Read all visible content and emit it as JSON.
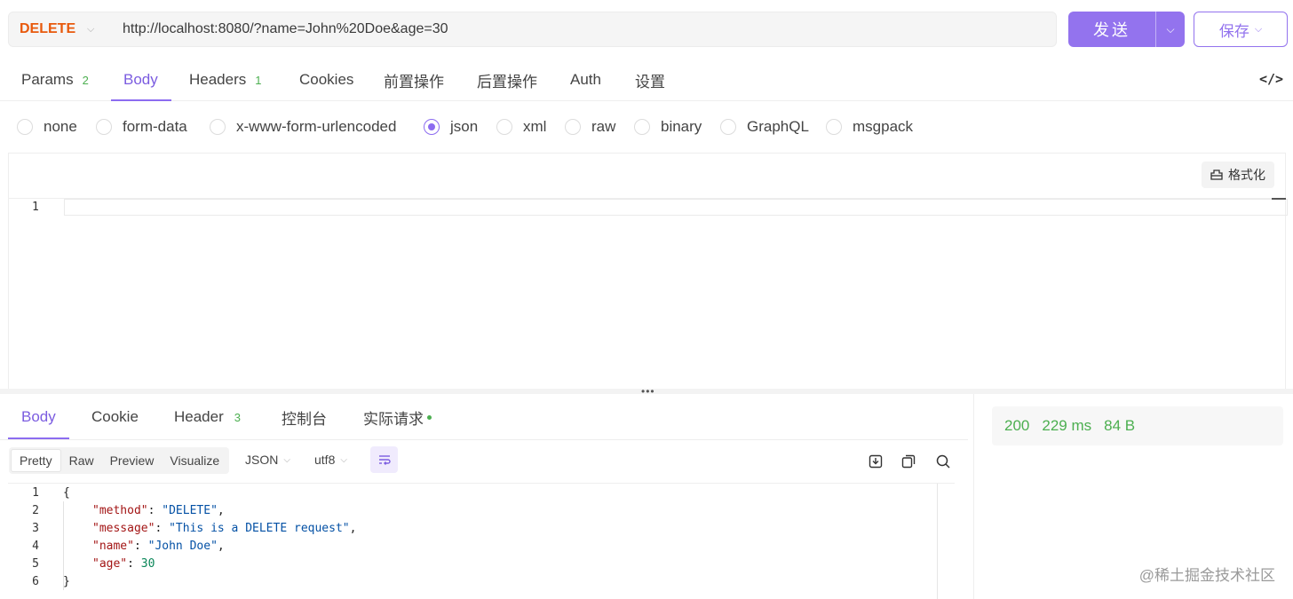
{
  "request": {
    "method": "DELETE",
    "url": "http://localhost:8080/?name=John%20Doe&age=30",
    "send_label": "发送",
    "save_label": "保存"
  },
  "request_tabs": [
    {
      "label": "Params",
      "count": "2"
    },
    {
      "label": "Body",
      "count": ""
    },
    {
      "label": "Headers",
      "count": "1"
    },
    {
      "label": "Cookies",
      "count": ""
    },
    {
      "label": "前置操作",
      "count": ""
    },
    {
      "label": "后置操作",
      "count": ""
    },
    {
      "label": "Auth",
      "count": ""
    },
    {
      "label": "设置",
      "count": ""
    }
  ],
  "code_toggle": "</>",
  "body_types": [
    "none",
    "form-data",
    "x-www-form-urlencoded",
    "json",
    "xml",
    "raw",
    "binary",
    "GraphQL",
    "msgpack"
  ],
  "selected_body_type": "json",
  "request_editor": {
    "format_label": "格式化",
    "line_number": "1"
  },
  "response_tabs": [
    {
      "label": "Body",
      "count": ""
    },
    {
      "label": "Cookie",
      "count": ""
    },
    {
      "label": "Header",
      "count": "3"
    },
    {
      "label": "控制台",
      "count": ""
    },
    {
      "label": "实际请求",
      "count": ""
    }
  ],
  "response_views": [
    "Pretty",
    "Raw",
    "Preview",
    "Visualize"
  ],
  "response_format": "JSON",
  "response_encoding": "utf8",
  "response_lines": [
    {
      "n": "1",
      "text": "{"
    },
    {
      "n": "2",
      "key": "\"method\"",
      "value": "\"DELETE\"",
      "type": "s",
      "comma": ","
    },
    {
      "n": "3",
      "key": "\"message\"",
      "value": "\"This is a DELETE request\"",
      "type": "s",
      "comma": ","
    },
    {
      "n": "4",
      "key": "\"name\"",
      "value": "\"John Doe\"",
      "type": "s",
      "comma": ","
    },
    {
      "n": "5",
      "key": "\"age\"",
      "value": "30",
      "type": "n",
      "comma": ""
    },
    {
      "n": "6",
      "text": "}"
    }
  ],
  "status": {
    "code": "200",
    "time": "229 ms",
    "size": "84 B"
  },
  "watermark": "@稀土掘金技术社区",
  "colors": {
    "accent": "#9373ee",
    "method": "#e8590c",
    "success": "#4caf50"
  }
}
